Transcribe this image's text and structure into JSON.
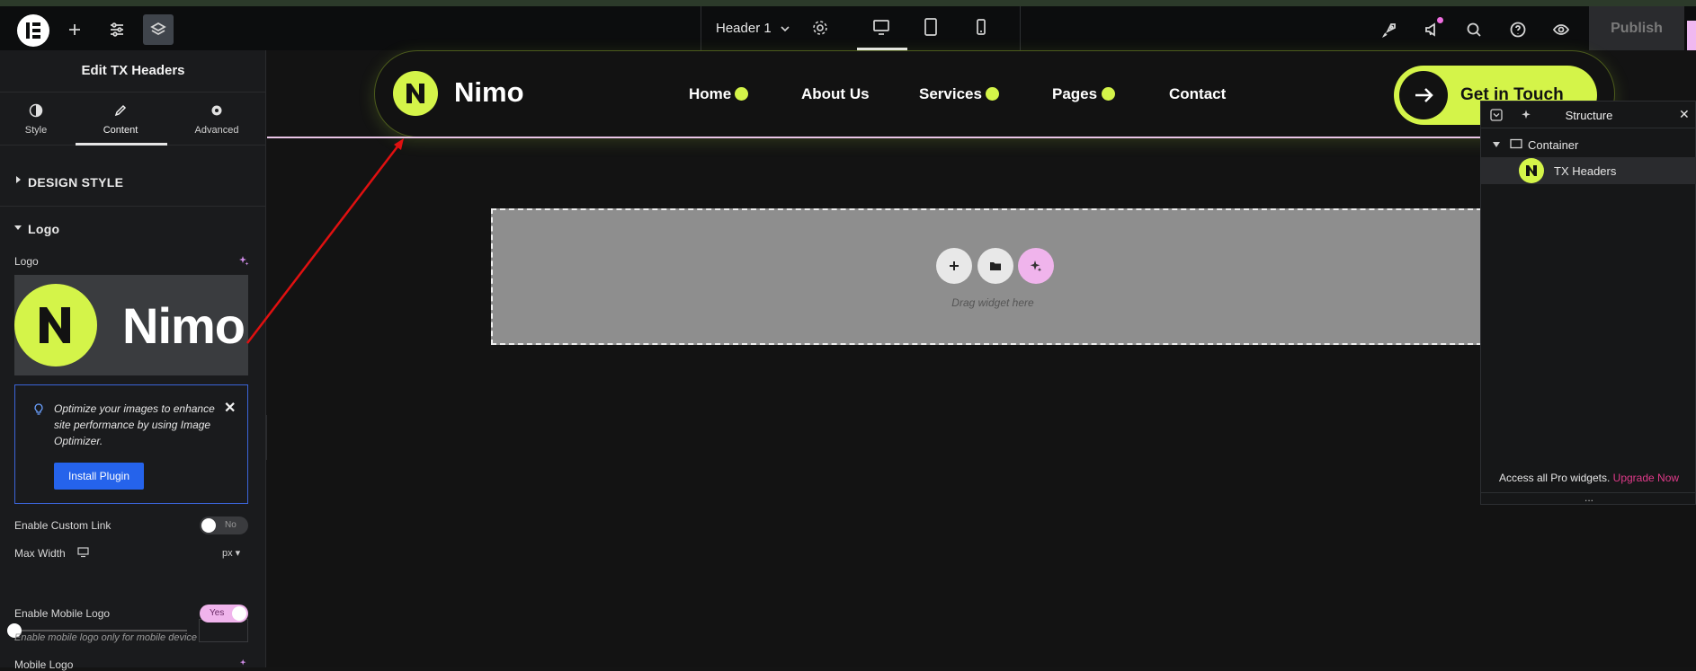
{
  "topbar": {
    "document_title": "Header 1",
    "publish_label": "Publish",
    "icons": [
      "elementor-logo-icon",
      "plus-icon",
      "sliders-icon",
      "layers-icon",
      "chevron-down-icon",
      "gear-icon",
      "desktop-icon",
      "tablet-icon",
      "mobile-icon",
      "rocket-icon",
      "megaphone-icon",
      "search-icon",
      "help-icon",
      "eye-icon"
    ]
  },
  "panel": {
    "title": "Edit TX Headers",
    "tabs": [
      {
        "label": "Style",
        "icon": "half-circle-icon"
      },
      {
        "label": "Content",
        "icon": "pencil-icon"
      },
      {
        "label": "Advanced",
        "icon": "gear-icon"
      }
    ],
    "active_tab": "Content",
    "sections": {
      "design_style": "DESIGN STYLE",
      "logo": "Logo"
    },
    "logo_label": "Logo",
    "logo_preview_text": "Nimo",
    "notice": {
      "text": "Optimize your images to enhance site performance by using Image Optimizer.",
      "button": "Install Plugin"
    },
    "custom_link": {
      "label": "Enable Custom Link",
      "value": "No"
    },
    "max_width": {
      "label": "Max Width",
      "unit": "px"
    },
    "mobile_logo_toggle": {
      "label": "Enable Mobile Logo",
      "value": "Yes",
      "help": "Enable mobile logo only for mobile device"
    },
    "mobile_logo_label": "Mobile Logo"
  },
  "canvas": {
    "site_logo_text": "Nimo",
    "nav": [
      {
        "label": "Home",
        "has_dropdown": true
      },
      {
        "label": "About Us",
        "has_dropdown": false
      },
      {
        "label": "Services",
        "has_dropdown": true
      },
      {
        "label": "Pages",
        "has_dropdown": true
      },
      {
        "label": "Contact",
        "has_dropdown": false
      }
    ],
    "cta_label": "Get in Touch",
    "dropzone_text": "Drag widget here",
    "accent_color": "#d4f449"
  },
  "structure": {
    "title": "Structure",
    "items": [
      {
        "label": "Container",
        "level": 0
      },
      {
        "label": "TX Headers",
        "level": 1
      }
    ],
    "promo_text": "Access all Pro widgets.",
    "promo_link": "Upgrade Now",
    "more": "..."
  }
}
